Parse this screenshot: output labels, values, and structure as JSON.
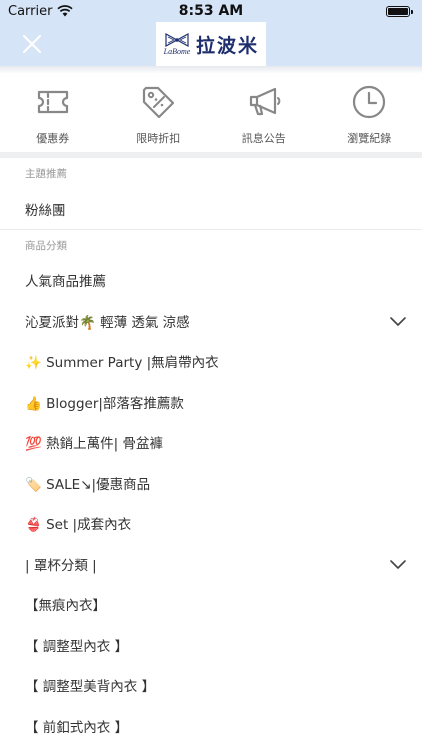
{
  "status_bar": {
    "carrier": "Carrier",
    "time": "8:53 AM"
  },
  "header": {
    "logo_latin": "LaBome",
    "logo_cjk": "拉波米",
    "brand_color": "#1f2f6e",
    "nav_color": "#d6e4f7"
  },
  "quick_actions": [
    {
      "label": "優惠券",
      "icon": "ticket-icon"
    },
    {
      "label": "限時折扣",
      "icon": "price-tag-icon"
    },
    {
      "label": "訊息公告",
      "icon": "megaphone-icon"
    },
    {
      "label": "瀏覽紀錄",
      "icon": "clock-icon"
    }
  ],
  "sections": {
    "featured_header": "主題推薦",
    "featured_item": "粉絲團",
    "category_header": "商品分類"
  },
  "categories": [
    "人氣商品推薦",
    "沁夏派對🌴 輕薄 透氣 涼感",
    "✨ Summer Party |無肩帶內衣",
    "👍 Blogger|部落客推薦款",
    "💯 熱銷上萬件| 骨盆褲",
    "🏷️ SALE↘|優惠商品",
    "👙 Set |成套內衣",
    "| 罩杯分類 |",
    "【無痕內衣】",
    "【 調整型內衣 】",
    "【 調整型美背內衣 】",
    "【 前釦式內衣 】"
  ]
}
